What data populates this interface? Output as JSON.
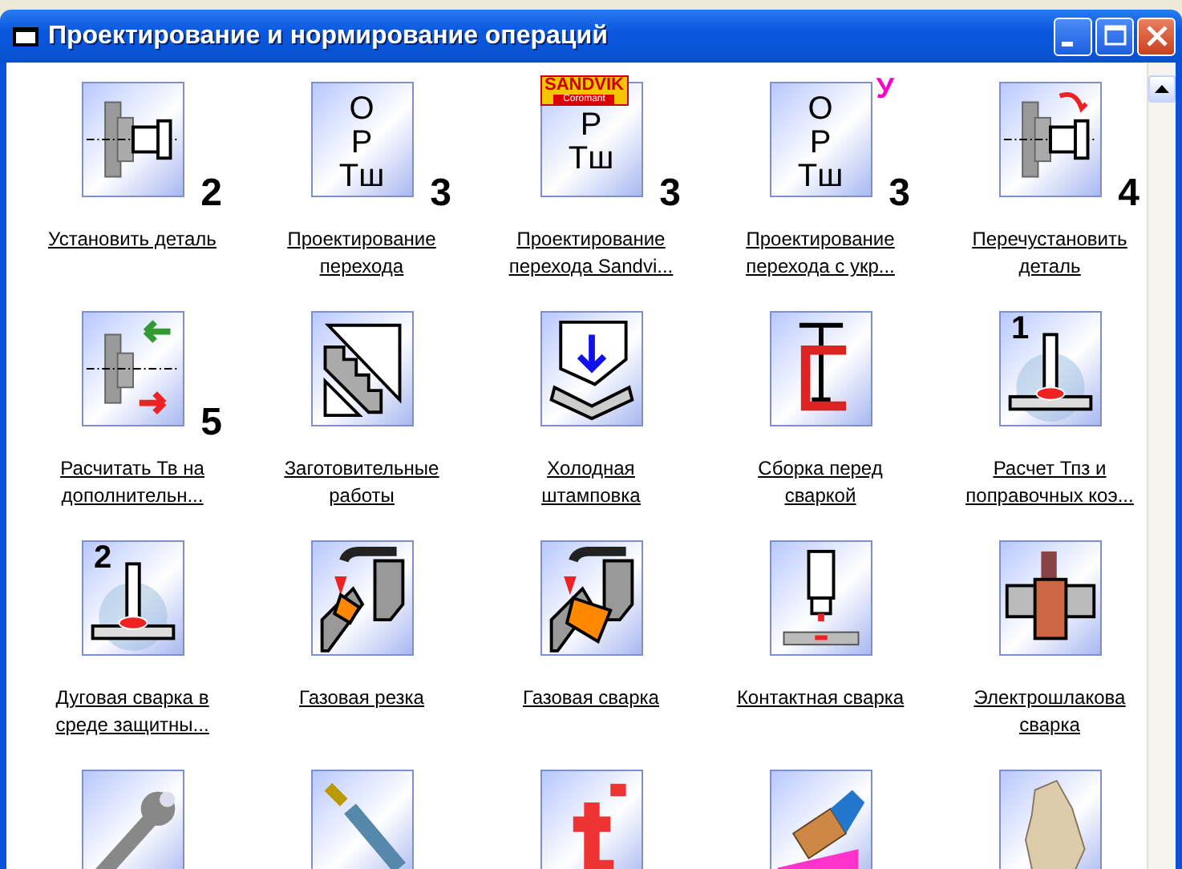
{
  "window": {
    "title": "Проектирование и нормирование операций"
  },
  "items": [
    {
      "kind": "fixture",
      "badge": "2",
      "label": [
        "Установить деталь"
      ]
    },
    {
      "kind": "card",
      "lines": [
        "О",
        "Р",
        "Тш"
      ],
      "badge": "3",
      "label": [
        "Проектирование",
        "перехода"
      ]
    },
    {
      "kind": "card",
      "lines": [
        "Р",
        "Тш"
      ],
      "brand": [
        "SANDVIK",
        "Coromant"
      ],
      "badge": "3",
      "label": [
        "Проектирование",
        "перехода Sandvi..."
      ]
    },
    {
      "kind": "card",
      "lines": [
        "О",
        "Р",
        "Тш"
      ],
      "mark": "У",
      "badge": "3",
      "label": [
        "Проектирование",
        "перехода с укр..."
      ]
    },
    {
      "kind": "reinstall",
      "badge": "4",
      "label": [
        "Перечустановить",
        "деталь"
      ]
    },
    {
      "kind": "recalc",
      "badge": "5",
      "label": [
        "Расчитать Тв на",
        "дополнительн..."
      ]
    },
    {
      "kind": "blank",
      "label": [
        "Заготовительные",
        "работы"
      ]
    },
    {
      "kind": "stamp",
      "label": [
        "Холодная",
        "штамповка"
      ]
    },
    {
      "kind": "clamp",
      "label": [
        "Сборка перед",
        "сваркой"
      ]
    },
    {
      "kind": "weld",
      "digit": "1",
      "label": [
        "Расчет Тпз и",
        "поправочных коэ..."
      ]
    },
    {
      "kind": "weld",
      "digit": "2",
      "label": [
        "Дуговая сварка в",
        "среде защитны..."
      ]
    },
    {
      "kind": "gascut",
      "label": [
        "Газовая резка"
      ]
    },
    {
      "kind": "gasweld",
      "label": [
        "Газовая сварка"
      ]
    },
    {
      "kind": "contact",
      "label": [
        "Контактная сварка"
      ]
    },
    {
      "kind": "slag",
      "label": [
        "Электрошлакова",
        "сварка"
      ]
    },
    {
      "kind": "wrench"
    },
    {
      "kind": "file"
    },
    {
      "kind": "tee"
    },
    {
      "kind": "brush"
    },
    {
      "kind": "stone"
    }
  ]
}
